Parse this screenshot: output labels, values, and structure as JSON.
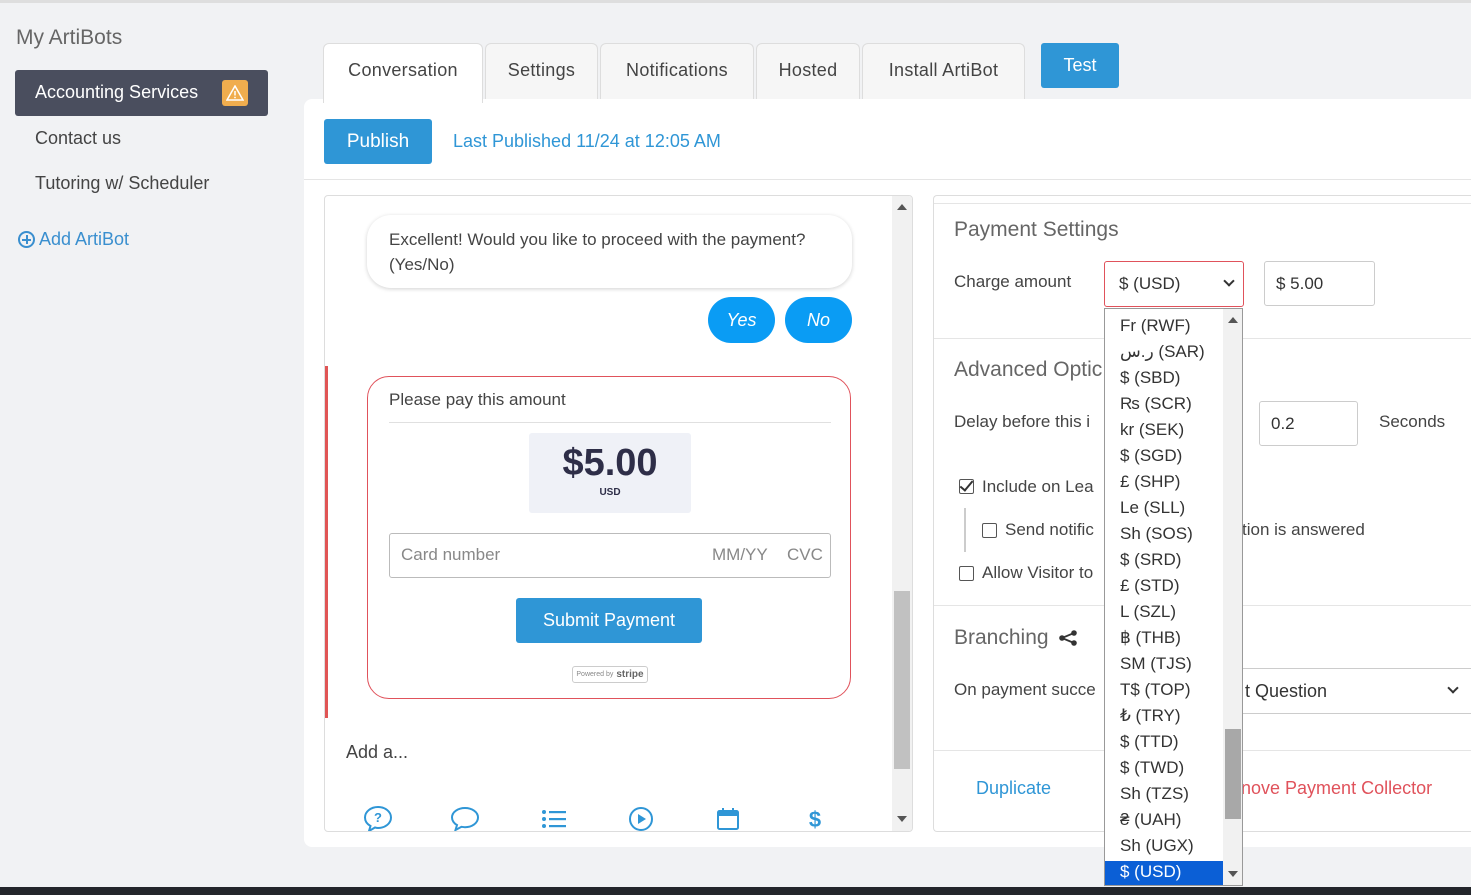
{
  "sidebar": {
    "title": "My ArtiBots",
    "items": [
      {
        "label": "Accounting Services"
      },
      {
        "label": "Contact us"
      },
      {
        "label": "Tutoring w/ Scheduler"
      }
    ],
    "add_label": "Add ArtiBot"
  },
  "tabs": [
    {
      "label": "Conversation"
    },
    {
      "label": "Settings"
    },
    {
      "label": "Notifications"
    },
    {
      "label": "Hosted"
    },
    {
      "label": "Install ArtiBot"
    }
  ],
  "test_label": "Test",
  "toolbar": {
    "publish_label": "Publish",
    "last_published": "Last Published 11/24 at 12:05 AM"
  },
  "chat": {
    "bot_message": "Excellent! Would you like to proceed with the payment? (Yes/No)",
    "chips": [
      {
        "label": "Yes"
      },
      {
        "label": "No"
      }
    ],
    "payment": {
      "title": "Please pay this amount",
      "amount": "$5.00",
      "currency": "USD",
      "card_placeholder": "Card number",
      "expiry_placeholder": "MM/YY",
      "cvc_placeholder": "CVC",
      "submit_label": "Submit Payment",
      "powered_by": "Powered by",
      "stripe": "stripe"
    },
    "add_label": "Add a...",
    "tool_icons": [
      "question-bubble-icon",
      "chat-bubble-icon",
      "list-icon",
      "play-icon",
      "calendar-icon",
      "dollar-icon"
    ]
  },
  "settings": {
    "payment_heading": "Payment Settings",
    "charge_label": "Charge amount",
    "currency_selected": "$ (USD)",
    "amount_value": "$ 5.00",
    "advanced_heading": "Advanced Optic",
    "delay_label": "Delay before this i",
    "delay_value": "0.2",
    "delay_unit": "Seconds",
    "include_label": "Include on Lea",
    "send_notif_label_start": "Send notific",
    "send_notif_label_end": "tion is answered",
    "allow_label": "Allow Visitor to",
    "branching_heading": "Branching",
    "on_payment_label": "On payment succe",
    "next_question": "t Question",
    "duplicate_label": "Duplicate",
    "remove_label": "nove Payment Collector"
  },
  "currency_dropdown": {
    "partial_top": "",
    "options": [
      "Fr (RWF)",
      "ر.س (SAR)",
      "$ (SBD)",
      "₨ (SCR)",
      "kr (SEK)",
      "$ (SGD)",
      "£ (SHP)",
      "Le (SLL)",
      "Sh (SOS)",
      "$ (SRD)",
      "£ (STD)",
      "L (SZL)",
      "฿ (THB)",
      "SM (TJS)",
      "T$ (TOP)",
      "₺ (TRY)",
      "$ (TTD)",
      "$ (TWD)",
      "Sh (TZS)",
      "₴ (UAH)",
      "Sh (UGX)",
      "$ (USD)"
    ],
    "selected_index": 21
  },
  "colors": {
    "accent": "#2f96d6",
    "chip": "#0a9cf4",
    "error": "#e0525b",
    "selected": "#0b5fd6",
    "warning": "#f0ad4e"
  }
}
